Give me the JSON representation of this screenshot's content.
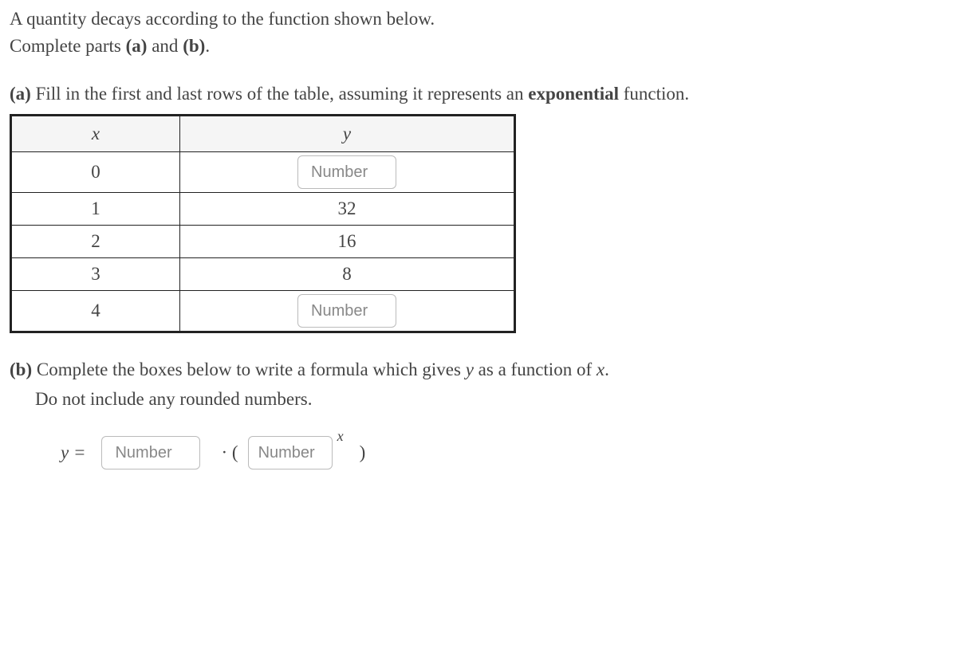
{
  "intro": {
    "line1": "A quantity decays according to the function shown below.",
    "line2_prefix": "Complete parts ",
    "line2_a": "(a)",
    "line2_and": " and ",
    "line2_b": "(b)",
    "line2_period": "."
  },
  "partA": {
    "label": "(a)",
    "text_prefix": " Fill in the first and last rows of the table, assuming it represents an ",
    "emphasis": "exponential",
    "text_suffix": " function."
  },
  "table": {
    "header_x": "x",
    "header_y": "y",
    "rows": [
      {
        "x": "0",
        "y_input_placeholder": "Number"
      },
      {
        "x": "1",
        "y_value": "32"
      },
      {
        "x": "2",
        "y_value": "16"
      },
      {
        "x": "3",
        "y_value": "8"
      },
      {
        "x": "4",
        "y_input_placeholder": "Number"
      }
    ]
  },
  "partB": {
    "label": "(b)",
    "text_prefix": " Complete the boxes below to write a formula which gives ",
    "var_y": "y",
    "text_mid": " as a function of ",
    "var_x": "x",
    "text_period": ".",
    "line2": "Do not include any rounded numbers."
  },
  "formula": {
    "y_equals": "y =",
    "coef_placeholder": "Number",
    "dot_open": "·  (",
    "base_placeholder": "Number",
    "exponent": "x",
    "close_paren": ")"
  }
}
